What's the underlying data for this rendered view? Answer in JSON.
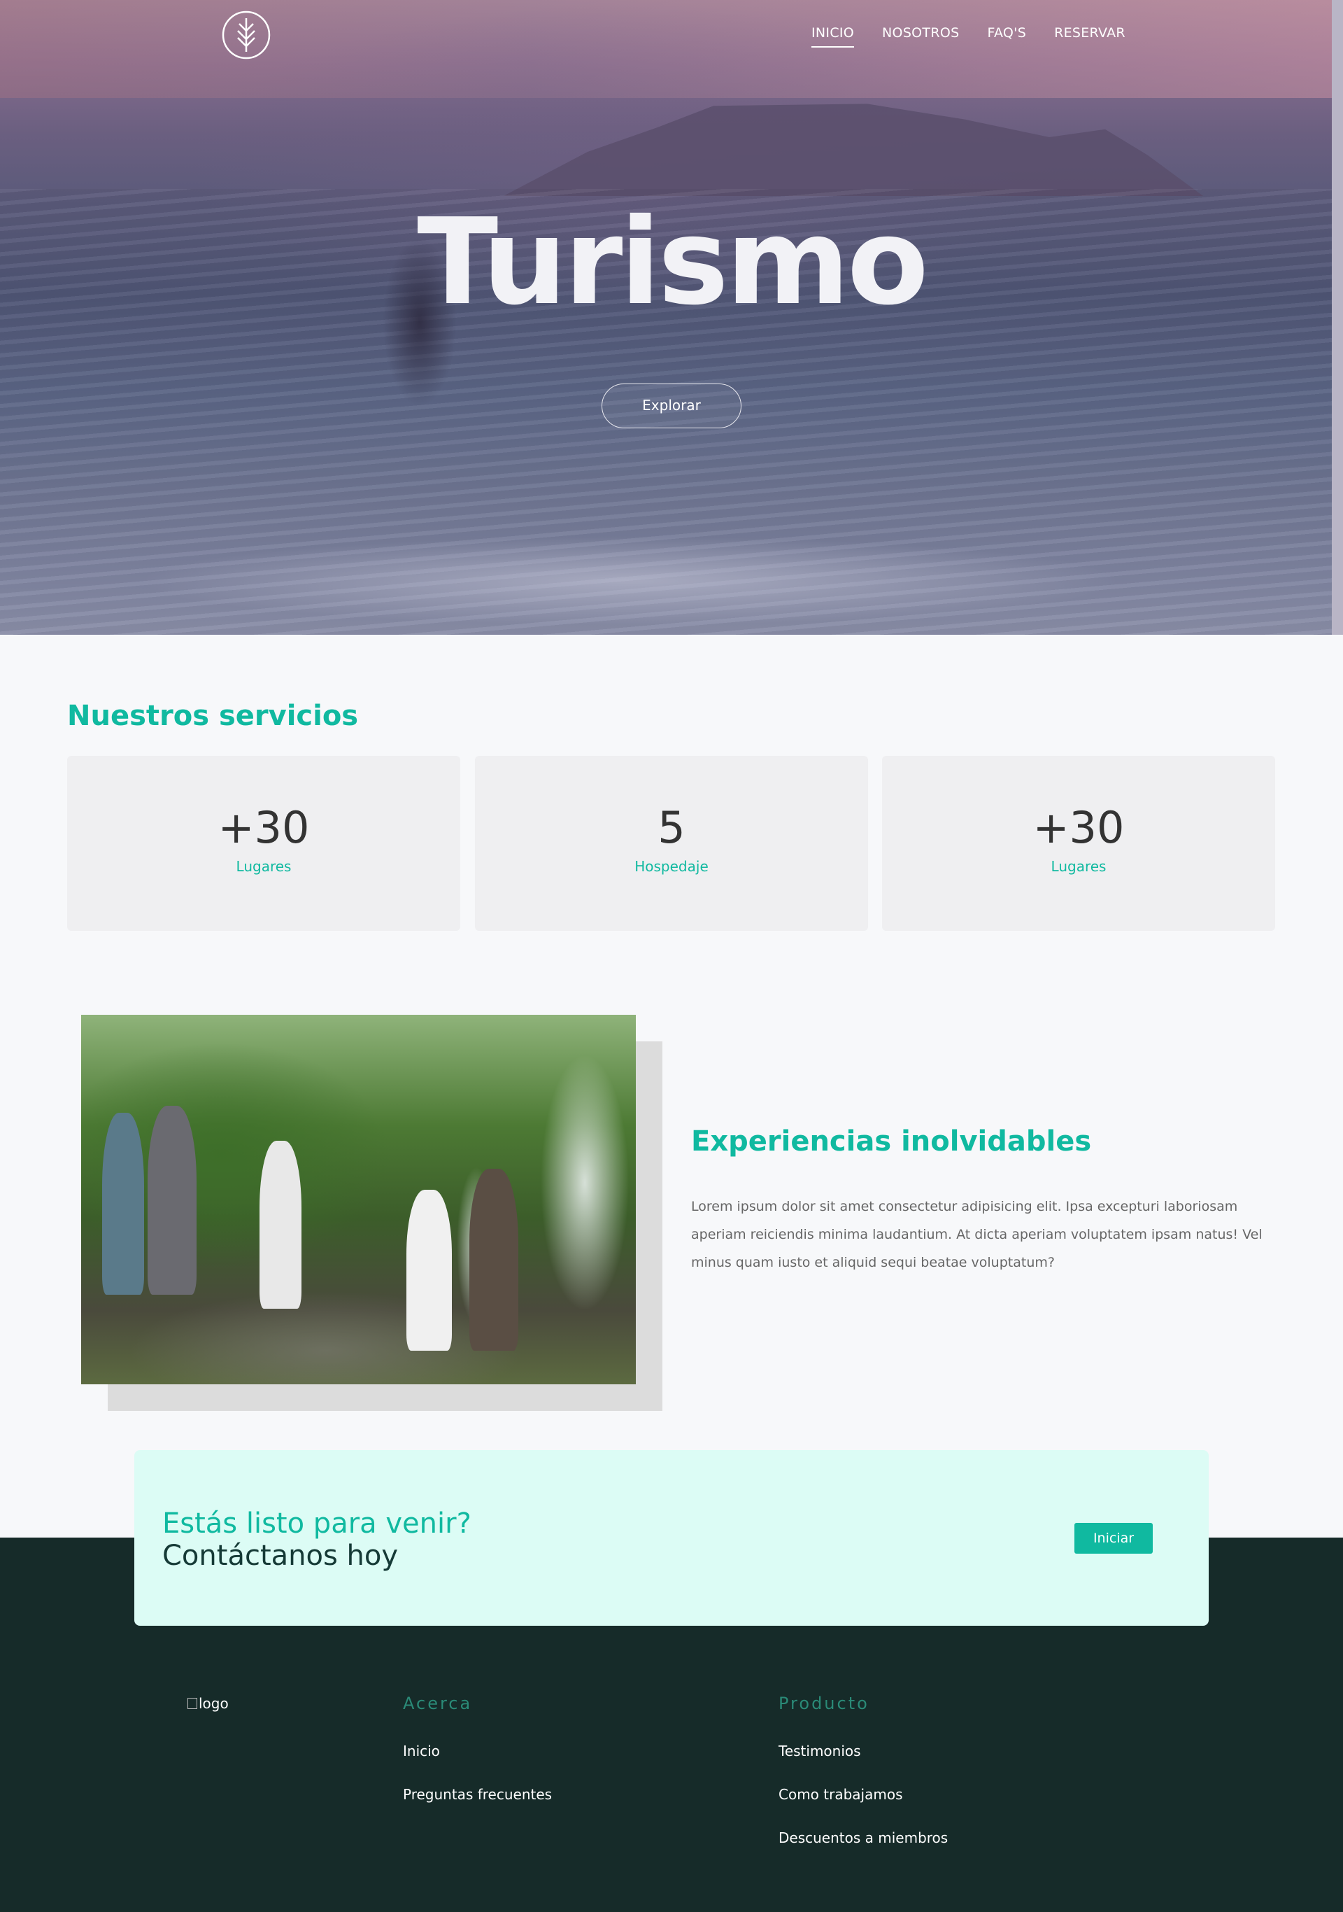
{
  "nav": {
    "items": [
      {
        "label": "INICIO",
        "active": true
      },
      {
        "label": "NOSOTROS",
        "active": false
      },
      {
        "label": "FAQ'S",
        "active": false
      },
      {
        "label": "RESERVAR",
        "active": false
      }
    ],
    "logo_icon": "leaf-logo-icon"
  },
  "hero": {
    "title": "Turismo",
    "button": "Explorar"
  },
  "services": {
    "title": "Nuestros servicios",
    "cards": [
      {
        "value": "+30",
        "label": "Lugares"
      },
      {
        "value": "5",
        "label": "Hospedaje"
      },
      {
        "value": "+30",
        "label": "Lugares"
      }
    ]
  },
  "experience": {
    "title": "Experiencias inolvidables",
    "text": "Lorem ipsum dolor sit amet consectetur adipisicing elit. Ipsa excepturi laboriosam aperiam reiciendis minima laudantium. At dicta aperiam voluptatem ipsam natus! Vel minus quam iusto et aliquid sequi beatae voluptatum?"
  },
  "cta": {
    "line1": "Estás listo para venir?",
    "line2": "Contáctanos hoy",
    "button": "Iniciar"
  },
  "footer": {
    "logo_alt": "logo",
    "columns": [
      {
        "heading": "Acerca",
        "links": [
          "Inicio",
          "Preguntas frecuentes"
        ]
      },
      {
        "heading": "Producto",
        "links": [
          "Testimonios",
          "Como trabajamos",
          "Descuentos a miembros"
        ]
      }
    ]
  },
  "colors": {
    "accent": "#10b9a0",
    "footer_bg": "#162b29",
    "cta_bg": "#dcfcf5",
    "page_bg": "#f7f8fa"
  }
}
